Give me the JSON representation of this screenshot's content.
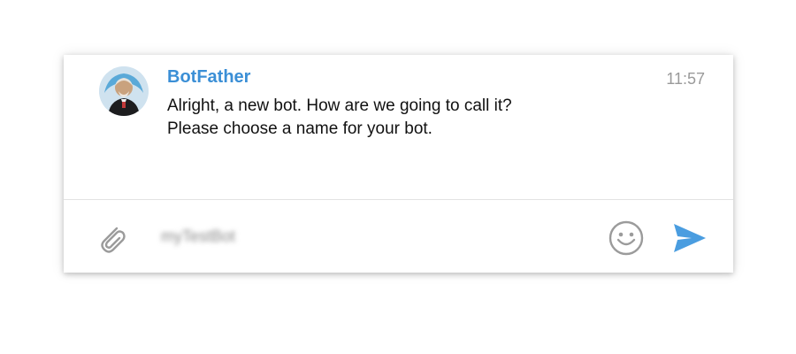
{
  "message": {
    "sender": "BotFather",
    "time": "11:57",
    "lines": [
      "Alright, a new bot. How are we going to call it?",
      "Please choose a name for your bot."
    ],
    "avatar_icon": "botfather-avatar"
  },
  "composer": {
    "input_value": "myTestBot",
    "attach_icon": "paperclip-icon",
    "emoji_icon": "smiley-icon",
    "send_icon": "send-arrow-icon"
  },
  "colors": {
    "sender_name": "#3b8fd6",
    "send_arrow": "#4a9de0",
    "icon_gray": "#9b9b9b"
  }
}
